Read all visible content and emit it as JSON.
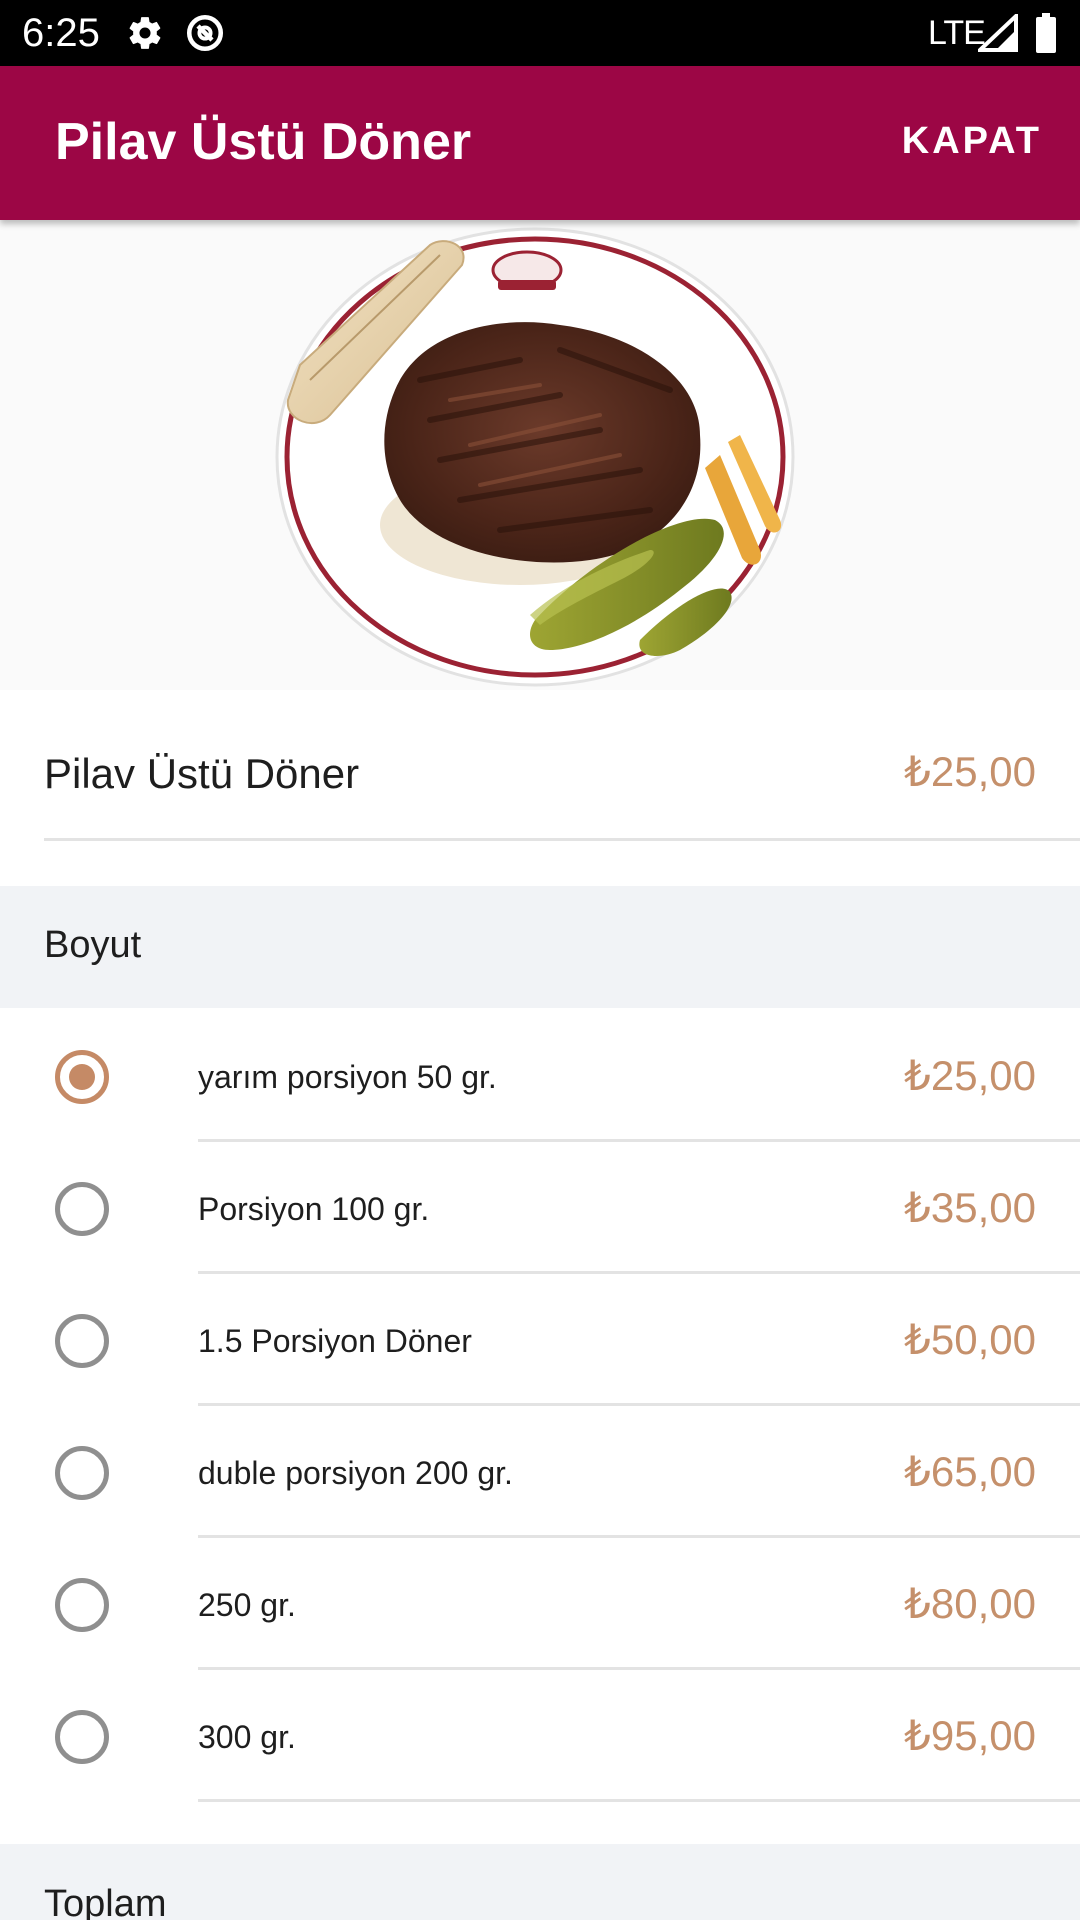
{
  "status_bar": {
    "time": "6:25",
    "network": "LTE",
    "icons": [
      "gear-icon",
      "data-saver-icon",
      "signal-icon",
      "battery-icon"
    ]
  },
  "app_bar": {
    "title": "Pilav Üstü Döner",
    "close_label": "KAPAT",
    "color": "#9c0645"
  },
  "product": {
    "name": "Pilav Üstü Döner",
    "price": "₺25,00"
  },
  "size_section": {
    "title": "Boyut",
    "selected_index": 0,
    "options": [
      {
        "label": "yarım porsiyon 50 gr.",
        "price": "₺25,00"
      },
      {
        "label": "Porsiyon 100 gr.",
        "price": "₺35,00"
      },
      {
        "label": "1.5 Porsiyon Döner",
        "price": "₺50,00"
      },
      {
        "label": "duble porsiyon 200 gr.",
        "price": "₺65,00"
      },
      {
        "label": "250 gr.",
        "price": "₺80,00"
      },
      {
        "label": "300 gr.",
        "price": "₺95,00"
      }
    ]
  },
  "total_section": {
    "title": "Toplam"
  },
  "colors": {
    "accent": "#c5906b",
    "radio_selected": "#c58a66",
    "section_bg": "#f1f3f6"
  }
}
